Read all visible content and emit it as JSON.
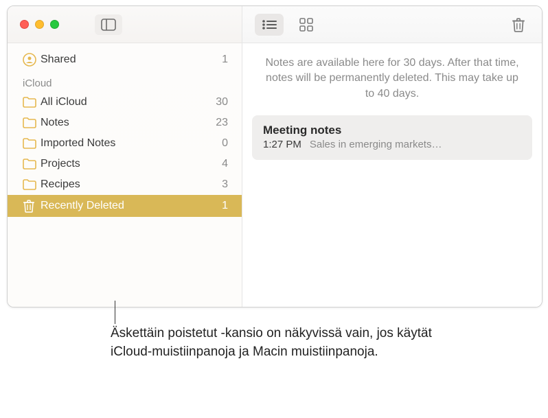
{
  "colors": {
    "accent": "#d9b857",
    "folder": "#e6b84f"
  },
  "sidebar": {
    "shared": {
      "label": "Shared",
      "count": 1
    },
    "section_header": "iCloud",
    "folders": [
      {
        "label": "All iCloud",
        "count": 30
      },
      {
        "label": "Notes",
        "count": 23
      },
      {
        "label": "Imported Notes",
        "count": 0
      },
      {
        "label": "Projects",
        "count": 4
      },
      {
        "label": "Recipes",
        "count": 3
      }
    ],
    "recently_deleted": {
      "label": "Recently Deleted",
      "count": 1
    }
  },
  "main": {
    "info_text": "Notes are available here for 30 days. After that time, notes will be permanently deleted. This may take up to 40 days.",
    "notes": [
      {
        "title": "Meeting notes",
        "time": "1:27 PM",
        "preview": "Sales in emerging markets…"
      }
    ]
  },
  "callout": "Äskettäin poistetut -kansio on näkyvissä vain, jos käytät iCloud-muistiinpanoja ja Macin muistiinpanoja."
}
